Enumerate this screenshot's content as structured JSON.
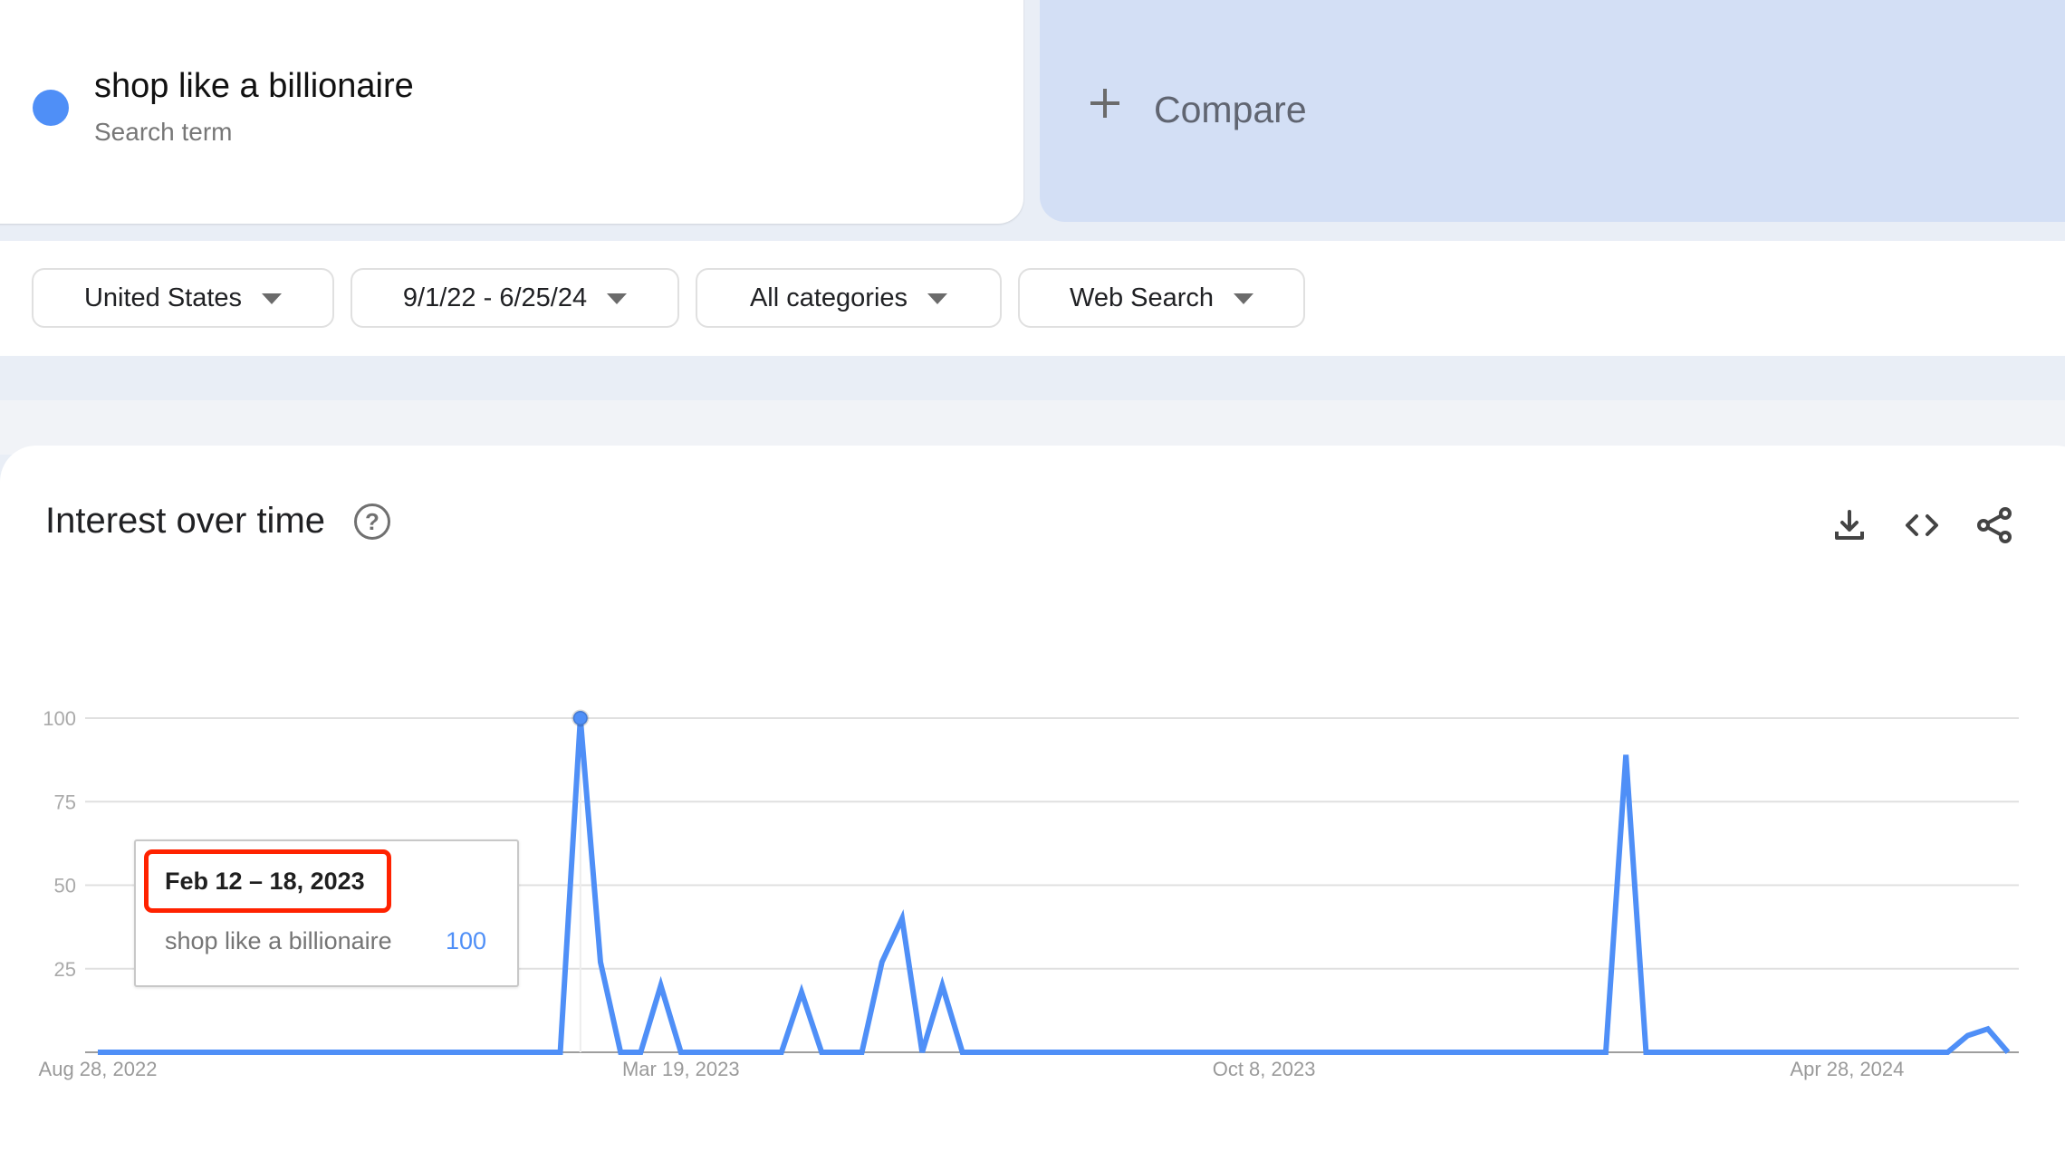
{
  "colors": {
    "series": "#4f8ff7",
    "accent_highlight": "#ff2200",
    "compare_bg": "#d3dff5"
  },
  "search_term": {
    "name": "shop like a billionaire",
    "subtitle": "Search term"
  },
  "compare": {
    "icon": "plus-icon",
    "label": "Compare"
  },
  "filters": [
    {
      "label": "United States",
      "icon": "caret-down-icon"
    },
    {
      "label": "9/1/22 - 6/25/24",
      "icon": "caret-down-icon"
    },
    {
      "label": "All categories",
      "icon": "caret-down-icon"
    },
    {
      "label": "Web Search",
      "icon": "caret-down-icon"
    }
  ],
  "chart_panel": {
    "title": "Interest over time",
    "help_icon": "?",
    "tools": [
      "download-icon",
      "embed-code-icon",
      "share-icon"
    ]
  },
  "tooltip": {
    "date": "Feb 12 – 18, 2023",
    "series": "shop like a billionaire",
    "value": "100",
    "highlighted_index": 24
  },
  "chart_data": {
    "type": "line",
    "title": "Interest over time",
    "xlabel": "",
    "ylabel": "",
    "ylim": [
      0,
      100
    ],
    "yticks": [
      25,
      50,
      75,
      100
    ],
    "grid": true,
    "x_start": "Aug 28, 2022",
    "x_interval": "weekly",
    "xtick_labels": [
      {
        "label": "Aug 28, 2022",
        "index": 0
      },
      {
        "label": "Mar 19, 2023",
        "index": 29
      },
      {
        "label": "Oct 8, 2023",
        "index": 58
      },
      {
        "label": "Apr 28, 2024",
        "index": 87
      }
    ],
    "series": [
      {
        "name": "shop like a billionaire",
        "values": [
          0,
          0,
          0,
          0,
          0,
          0,
          0,
          0,
          0,
          0,
          0,
          0,
          0,
          0,
          0,
          0,
          0,
          0,
          0,
          0,
          0,
          0,
          0,
          0,
          100,
          27,
          0,
          0,
          20,
          0,
          0,
          0,
          0,
          0,
          0,
          18,
          0,
          0,
          0,
          27,
          40,
          0,
          20,
          0,
          0,
          0,
          0,
          0,
          0,
          0,
          0,
          0,
          0,
          0,
          0,
          0,
          0,
          0,
          0,
          0,
          0,
          0,
          0,
          0,
          0,
          0,
          0,
          0,
          0,
          0,
          0,
          0,
          0,
          0,
          0,
          0,
          89,
          0,
          0,
          0,
          0,
          0,
          0,
          0,
          0,
          0,
          0,
          0,
          0,
          0,
          0,
          0,
          0,
          5,
          7,
          0
        ]
      }
    ]
  }
}
